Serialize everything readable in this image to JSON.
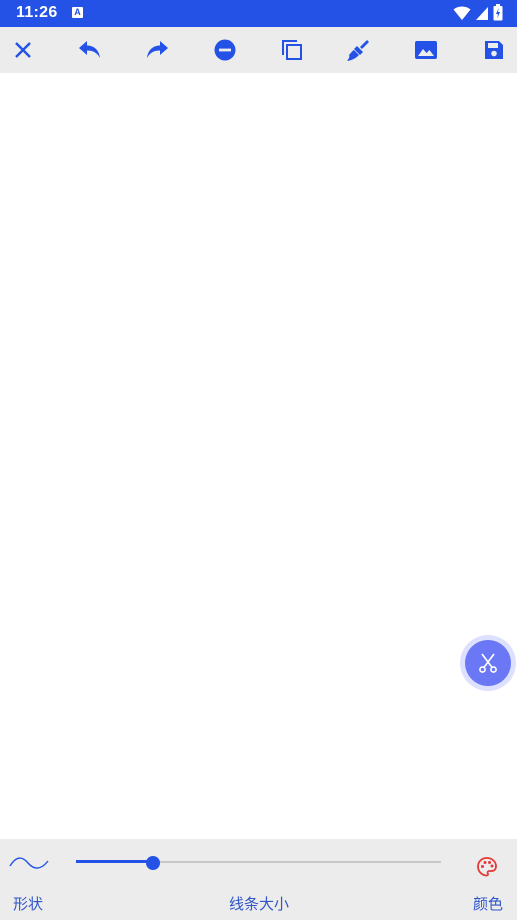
{
  "status": {
    "time": "11:26",
    "notification_badge": "A"
  },
  "toolbar": {
    "icons": [
      "close-icon",
      "undo-icon",
      "redo-icon",
      "remove-icon",
      "copy-icon",
      "clear-brush-icon",
      "image-icon",
      "save-icon"
    ],
    "color": "#2452e6"
  },
  "fab": {
    "icon": "scissors-icon",
    "color": "#6b78f5"
  },
  "bottom": {
    "shape_label": "形状",
    "line_size_label": "线条大小",
    "color_label": "颜色",
    "line_size_fraction": 0.21,
    "palette_color": "#e53935"
  }
}
